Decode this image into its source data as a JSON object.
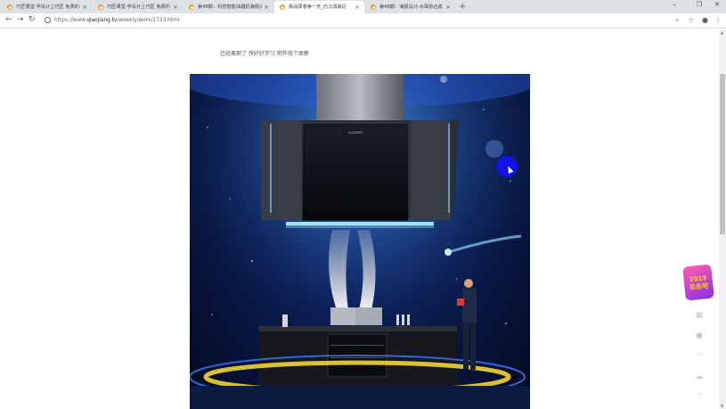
{
  "tabs": [
    {
      "title": "巧匠课堂-学设计上巧匠 免费的",
      "active": false
    },
    {
      "title": "巧匠课堂-学设计上巧匠 免费的",
      "active": false
    },
    {
      "title": "第48期：科技智能油烟机海报设",
      "active": false
    },
    {
      "title": "挑战周卷第一天_仍沉溺最近",
      "active": true
    },
    {
      "title": "第48期：海报设计-水珠效合成",
      "active": false
    }
  ],
  "toolbar": {
    "url_prefix": "https://www.",
    "url_domain": "qiaojiang.tv",
    "url_path": "/weekly/work/1733.html"
  },
  "post": {
    "comment": "已经离职了 想好好学习 明年找个周薪"
  },
  "artwork": {
    "brand_label": "CASARTE"
  },
  "sidebar": {
    "promo_label_top": "2019",
    "promo_label_bottom": "花名吧"
  },
  "colors": {
    "accent": "#1014e6",
    "tab_bar": "#dee1e6"
  }
}
